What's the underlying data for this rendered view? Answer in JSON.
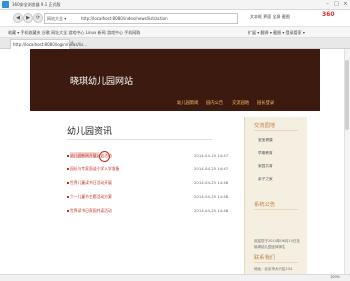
{
  "browser": {
    "title": "360安全浏览器 9.1 正式版",
    "url_prefix": "网站大全 ▾",
    "url": "http://localhost:8080/index/news/list/action",
    "right_tools": "文本框  界面  全屏  截图",
    "brand": "360",
    "green_badge": "登录管家",
    "bookmarks_left": "收藏 ▾  手机收藏夹  谷歌  网址大全  游戏中心  Linux  新闻  游戏中心  手机网购",
    "bookmarks_right": "扩展 ▾  翻译 ▾  截图 ▾  登录管家 ▾",
    "tab": "http://localhost:8080/login/news/lis...",
    "zoom": "100%"
  },
  "site": {
    "title": "晓琪幼儿园网站",
    "nav": [
      "幼儿园新闻",
      "园内公告",
      "交流园地",
      "园长登录"
    ]
  },
  "main": {
    "title": "幼儿园资讯",
    "news": [
      {
        "title": "幼儿园新闻开展公益活动",
        "date": "2014-04-25 14:47"
      },
      {
        "title": "园长与专家面谈小学入学准备",
        "date": "2014-04-25 14:47"
      },
      {
        "title": "世界儿童读书日活动开展",
        "date": "2014-04-25 14:48"
      },
      {
        "title": "六一儿童节主题活动方案",
        "date": "2014-04-25 14:48"
      },
      {
        "title": "世界读书日家园共读活动",
        "date": "2014-04-25 14:48"
      }
    ]
  },
  "sidebar": {
    "heading1": "交流园地",
    "links": [
      "宝宝健康",
      "早期教育",
      "家园共育",
      "亲子之家"
    ],
    "heading2": "系统公告",
    "heading3": "联系我们",
    "notice": "欢迎您于2014年06月14日至",
    "notice2": "晓琪幼儿园全体师生",
    "contact": "地址：北京市大兴区234"
  }
}
